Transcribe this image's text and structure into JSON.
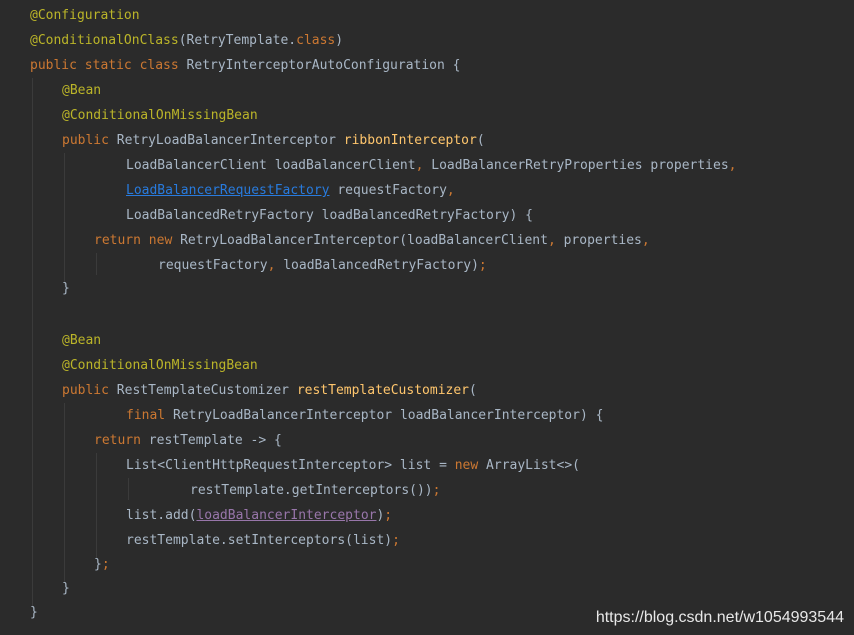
{
  "editor": {
    "lines": [
      {
        "tokens": [
          {
            "text": "@Configuration",
            "kind": "annotation"
          }
        ]
      },
      {
        "tokens": [
          {
            "text": "@ConditionalOnClass",
            "kind": "annotation"
          },
          {
            "text": "(RetryTemplate.",
            "kind": "plain"
          },
          {
            "text": "class",
            "kind": "keyword"
          },
          {
            "text": ")",
            "kind": "plain"
          }
        ]
      },
      {
        "tokens": [
          {
            "text": "public static class ",
            "kind": "keyword"
          },
          {
            "text": "RetryInterceptorAutoConfiguration {",
            "kind": "plain"
          }
        ]
      },
      {
        "tokens": [
          {
            "text": "@Bean",
            "kind": "annotation"
          }
        ]
      },
      {
        "tokens": [
          {
            "text": "@ConditionalOnMissingBean",
            "kind": "annotation"
          }
        ]
      },
      {
        "tokens": [
          {
            "text": "public ",
            "kind": "keyword"
          },
          {
            "text": "RetryLoadBalancerInterceptor ",
            "kind": "plain"
          },
          {
            "text": "ribbonInterceptor",
            "kind": "method"
          },
          {
            "text": "(",
            "kind": "plain"
          }
        ]
      },
      {
        "tokens": [
          {
            "text": "LoadBalancerClient loadBalancerClient",
            "kind": "plain"
          },
          {
            "text": ", ",
            "kind": "keyword"
          },
          {
            "text": "LoadBalancerRetryProperties properties",
            "kind": "plain"
          },
          {
            "text": ",",
            "kind": "keyword"
          }
        ]
      },
      {
        "tokens": [
          {
            "text": "LoadBalancerRequestFactory",
            "kind": "link"
          },
          {
            "text": " requestFactory",
            "kind": "plain"
          },
          {
            "text": ",",
            "kind": "keyword"
          }
        ]
      },
      {
        "tokens": [
          {
            "text": "LoadBalancedRetryFactory loadBalancedRetryFactory) {",
            "kind": "plain"
          }
        ]
      },
      {
        "tokens": [
          {
            "text": "return new ",
            "kind": "keyword"
          },
          {
            "text": "RetryLoadBalancerInterceptor(loadBalancerClient",
            "kind": "plain"
          },
          {
            "text": ", ",
            "kind": "keyword"
          },
          {
            "text": "properties",
            "kind": "plain"
          },
          {
            "text": ",",
            "kind": "keyword"
          }
        ]
      },
      {
        "tokens": [
          {
            "text": "requestFactory",
            "kind": "plain"
          },
          {
            "text": ", ",
            "kind": "keyword"
          },
          {
            "text": "loadBalancedRetryFactory)",
            "kind": "plain"
          },
          {
            "text": ";",
            "kind": "keyword"
          }
        ]
      },
      {
        "tokens": [
          {
            "text": "}",
            "kind": "plain"
          }
        ]
      },
      {
        "tokens": [
          {
            "text": "",
            "kind": "plain"
          }
        ]
      },
      {
        "tokens": [
          {
            "text": "@Bean",
            "kind": "annotation"
          }
        ]
      },
      {
        "tokens": [
          {
            "text": "@ConditionalOnMissingBean",
            "kind": "annotation"
          }
        ]
      },
      {
        "tokens": [
          {
            "text": "public ",
            "kind": "keyword"
          },
          {
            "text": "RestTemplateCustomizer ",
            "kind": "plain"
          },
          {
            "text": "restTemplateCustomizer",
            "kind": "method"
          },
          {
            "text": "(",
            "kind": "plain"
          }
        ]
      },
      {
        "tokens": [
          {
            "text": "final ",
            "kind": "keyword"
          },
          {
            "text": "RetryLoadBalancerInterceptor loadBalancerInterceptor) {",
            "kind": "plain"
          }
        ]
      },
      {
        "tokens": [
          {
            "text": "return ",
            "kind": "keyword"
          },
          {
            "text": "restTemplate -> {",
            "kind": "plain"
          }
        ]
      },
      {
        "tokens": [
          {
            "text": "List<ClientHttpRequestInterceptor> list = ",
            "kind": "plain"
          },
          {
            "text": "new ",
            "kind": "keyword"
          },
          {
            "text": "ArrayList<>(",
            "kind": "plain"
          }
        ]
      },
      {
        "tokens": [
          {
            "text": "restTemplate.getInterceptors())",
            "kind": "plain"
          },
          {
            "text": ";",
            "kind": "keyword"
          }
        ]
      },
      {
        "tokens": [
          {
            "text": "list.add(",
            "kind": "plain"
          },
          {
            "text": "loadBalancerInterceptor",
            "kind": "field"
          },
          {
            "text": ")",
            "kind": "plain"
          },
          {
            "text": ";",
            "kind": "keyword"
          }
        ]
      },
      {
        "tokens": [
          {
            "text": "restTemplate.setInterceptors(list)",
            "kind": "plain"
          },
          {
            "text": ";",
            "kind": "keyword"
          }
        ]
      },
      {
        "tokens": [
          {
            "text": "}",
            "kind": "plain"
          },
          {
            "text": ";",
            "kind": "keyword"
          }
        ]
      },
      {
        "tokens": [
          {
            "text": "}",
            "kind": "plain"
          }
        ]
      },
      {
        "tokens": [
          {
            "text": "}",
            "kind": "plain"
          }
        ]
      }
    ]
  },
  "watermark": "https://blog.csdn.net/w1054993544",
  "colors": {
    "background": "#2b2b2b",
    "annotation": "#bbb529",
    "keyword": "#cc7832",
    "method": "#ffc66d",
    "plain": "#a9b7c6",
    "link": "#287bde",
    "field": "#9876aa"
  }
}
